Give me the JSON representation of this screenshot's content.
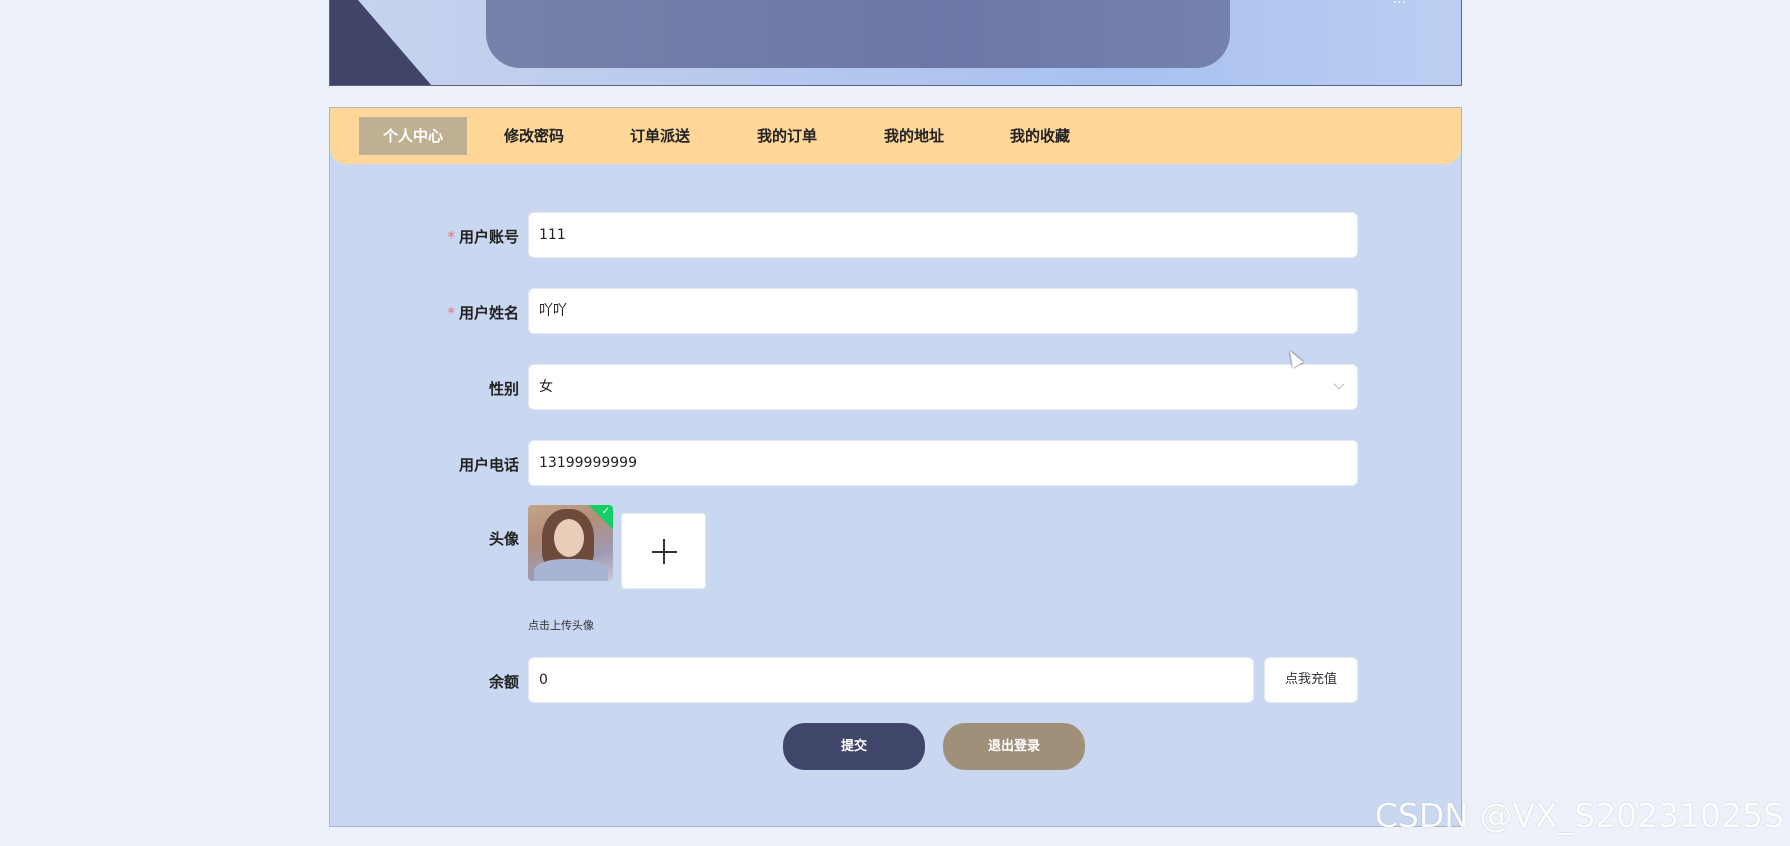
{
  "banner": {
    "text": "..."
  },
  "tabs": [
    {
      "label": "个人中心",
      "active": true
    },
    {
      "label": "修改密码",
      "active": false
    },
    {
      "label": "订单派送",
      "active": false
    },
    {
      "label": "我的订单",
      "active": false
    },
    {
      "label": "我的地址",
      "active": false
    },
    {
      "label": "我的收藏",
      "active": false
    }
  ],
  "form": {
    "account": {
      "label": "用户账号",
      "value": "111",
      "required": true
    },
    "name": {
      "label": "用户姓名",
      "value": "吖吖",
      "required": true
    },
    "gender": {
      "label": "性别",
      "value": "女"
    },
    "phone": {
      "label": "用户电话",
      "value": "13199999999"
    },
    "avatar": {
      "label": "头像",
      "hint": "点击上传头像"
    },
    "balance": {
      "label": "余额",
      "value": "0",
      "recharge_label": "点我充值"
    },
    "required_mark": "*"
  },
  "actions": {
    "submit_label": "提交",
    "logout_label": "退出登录"
  },
  "watermark": "CSDN @VX_S20231025S",
  "colors": {
    "tabbar": "#fed799",
    "active_tab": "#bfb094",
    "submit": "#40456a",
    "logout": "#a0907a",
    "card": "#c9d8f0"
  }
}
